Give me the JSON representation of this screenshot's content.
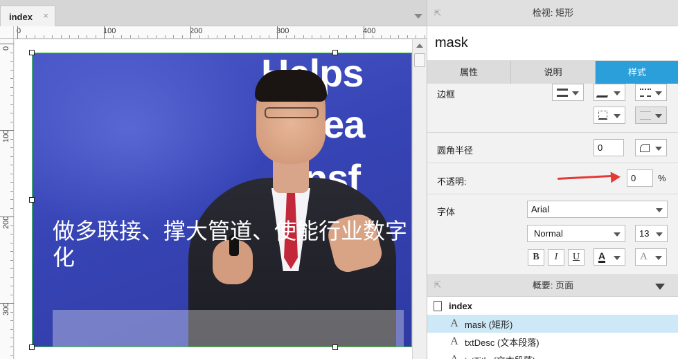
{
  "editor": {
    "tab_label": "index",
    "tab_close": "×",
    "ruler_h_labels": [
      "0",
      "100",
      "200",
      "300",
      "400"
    ],
    "ruler_v_labels": [
      "0",
      "100",
      "200",
      "300"
    ]
  },
  "canvas": {
    "screen_text": [
      "Helps",
      "ncrea",
      "nsf"
    ],
    "overlay_title": "做多联接、撑大管道、使能行业数字化"
  },
  "inspector": {
    "header": "检视: 矩形",
    "widget_name": "mask",
    "tabs": [
      "属性",
      "说明",
      "样式"
    ],
    "active_tab": "样式",
    "border_label": "边框",
    "radius_label": "圆角半径",
    "radius_value": "0",
    "opacity_label": "不透明:",
    "opacity_value": "0",
    "opacity_unit": "%",
    "font_label": "字体",
    "font_family": "Arial",
    "font_weight": "Normal",
    "font_size": "13",
    "bold_glyph": "B",
    "italic_glyph": "I",
    "underline_glyph": "U",
    "font_color_glyph": "A",
    "text_shadow_glyph": "A",
    "accent_color": "#2b9fd9",
    "annotation_arrow_color": "#e53935"
  },
  "outline": {
    "header": "概要: 页面",
    "page": "index",
    "items": [
      {
        "label": "mask (矩形)",
        "selected": true
      },
      {
        "label": "txtDesc (文本段落)",
        "selected": false
      },
      {
        "label": "txtTitle (文本段落)",
        "selected": false
      }
    ]
  }
}
